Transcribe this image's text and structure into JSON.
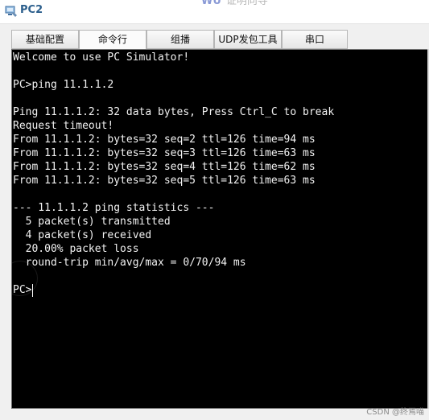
{
  "window": {
    "title": "PC2",
    "bg_text_fragment": "WU",
    "bg_text_fragment2": "证明向导"
  },
  "tabs": [
    {
      "label": "基础配置",
      "active": false
    },
    {
      "label": "命令行",
      "active": true
    },
    {
      "label": "组播",
      "active": false
    },
    {
      "label": "UDP发包工具",
      "active": false
    },
    {
      "label": "串口",
      "active": false
    }
  ],
  "terminal": {
    "lines": [
      "Welcome to use PC Simulator!",
      "",
      "PC>ping 11.1.1.2",
      "",
      "Ping 11.1.1.2: 32 data bytes, Press Ctrl_C to break",
      "Request timeout!",
      "From 11.1.1.2: bytes=32 seq=2 ttl=126 time=94 ms",
      "From 11.1.1.2: bytes=32 seq=3 ttl=126 time=63 ms",
      "From 11.1.1.2: bytes=32 seq=4 ttl=126 time=62 ms",
      "From 11.1.1.2: bytes=32 seq=5 ttl=126 time=63 ms",
      "",
      "--- 11.1.1.2 ping statistics ---",
      "  5 packet(s) transmitted",
      "  4 packet(s) received",
      "  20.00% packet loss",
      "  round-trip min/avg/max = 0/70/94 ms",
      ""
    ],
    "prompt": "PC>",
    "colors": {
      "background": "#000000",
      "foreground": "#f2f2f2"
    }
  },
  "watermark": "CSDN @终焉喵"
}
